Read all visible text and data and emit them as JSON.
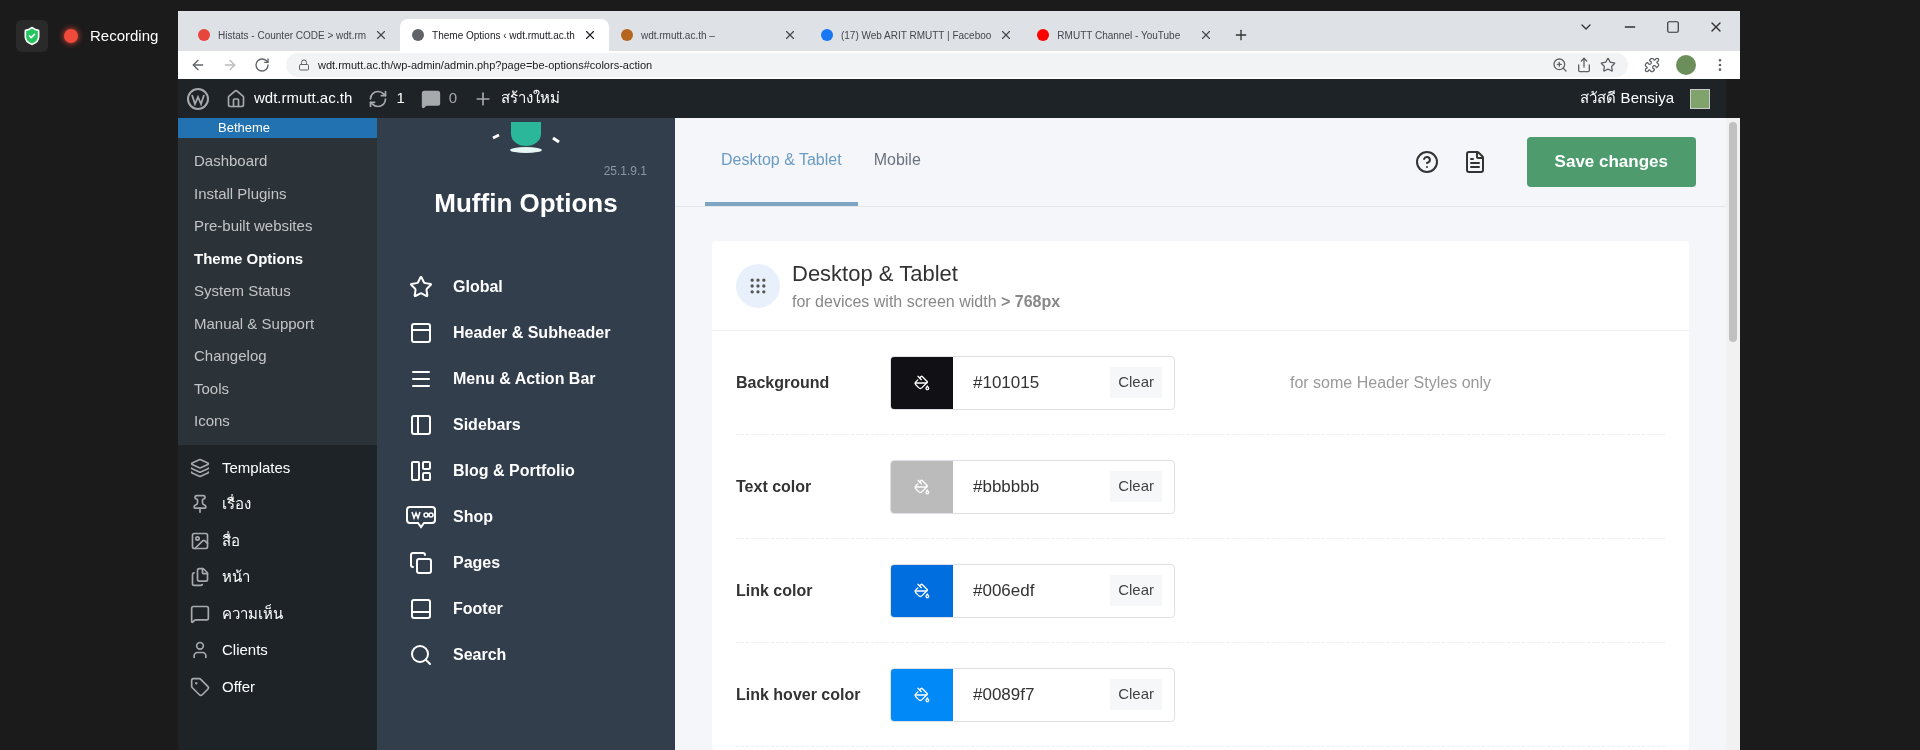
{
  "recorder": {
    "label": "Recording"
  },
  "browser": {
    "tabs": [
      {
        "title": "Histats - Counter CODE > wdt.rm",
        "selected": false,
        "color": "#e8453c"
      },
      {
        "title": "Theme Options ‹ wdt.rmutt.ac.th",
        "selected": true,
        "color": "#5f6368"
      },
      {
        "title": "wdt.rmutt.ac.th –",
        "selected": false,
        "color": "#b5651d"
      },
      {
        "title": "(17) Web ARIT RMUTT | Faceboo",
        "selected": false,
        "color": "#1877f2"
      },
      {
        "title": "RMUTT Channel - YouTube",
        "selected": false,
        "color": "#ff0000"
      }
    ],
    "url": "wdt.rmutt.ac.th/wp-admin/admin.php?page=be-options#colors-action"
  },
  "admin_bar": {
    "site": "wdt.rmutt.ac.th",
    "updates": "1",
    "comments": "0",
    "new": "สร้างใหม่",
    "greeting": "สวัสดี Bensiya"
  },
  "wp_menu": {
    "parent": "Betheme",
    "submenu": [
      {
        "label": "Dashboard",
        "selected": false
      },
      {
        "label": "Install Plugins",
        "selected": false
      },
      {
        "label": "Pre-built websites",
        "selected": false
      },
      {
        "label": "Theme Options",
        "selected": true
      },
      {
        "label": "System Status",
        "selected": false
      },
      {
        "label": "Manual & Support",
        "selected": false
      },
      {
        "label": "Changelog",
        "selected": false
      },
      {
        "label": "Tools",
        "selected": false
      },
      {
        "label": "Icons",
        "selected": false
      }
    ],
    "items": [
      {
        "label": "Templates",
        "kind": "templates"
      },
      {
        "label": "เรื่อง",
        "kind": "pin"
      },
      {
        "label": "สื่อ",
        "kind": "media"
      },
      {
        "label": "หน้า",
        "kind": "pages"
      },
      {
        "label": "ความเห็น",
        "kind": "comments"
      },
      {
        "label": "Clients",
        "kind": "user"
      },
      {
        "label": "Offer",
        "kind": "tag"
      }
    ]
  },
  "muffin": {
    "version": "25.1.9.1",
    "title": "Muffin Options",
    "nav": [
      {
        "label": "Global",
        "kind": "star"
      },
      {
        "label": "Header & Subheader",
        "kind": "header"
      },
      {
        "label": "Menu & Action Bar",
        "kind": "menu"
      },
      {
        "label": "Sidebars",
        "kind": "sidebar"
      },
      {
        "label": "Blog & Portfolio",
        "kind": "blog"
      },
      {
        "label": "Shop",
        "kind": "woo"
      },
      {
        "label": "Pages",
        "kind": "pages"
      },
      {
        "label": "Footer",
        "kind": "footer"
      },
      {
        "label": "Search",
        "kind": "search"
      }
    ]
  },
  "content": {
    "tabs": [
      {
        "label": "Desktop & Tablet",
        "selected": true
      },
      {
        "label": "Mobile",
        "selected": false
      }
    ],
    "save": "Save changes",
    "card": {
      "title": "Desktop & Tablet",
      "subtitle": "for devices with screen width **> 768px**",
      "rows": [
        {
          "label": "Background",
          "value": "#101015",
          "color": "#101015",
          "clear": "Clear",
          "note": "for some Header Styles only"
        },
        {
          "label": "Text color",
          "value": "#bbbbbb",
          "color": "#bbbbbb",
          "clear": "Clear"
        },
        {
          "label": "Link color",
          "value": "#006edf",
          "color": "#006edf",
          "clear": "Clear"
        },
        {
          "label": "Link hover color",
          "value": "#0089f7",
          "color": "#0089f7",
          "clear": "Clear"
        }
      ]
    }
  }
}
